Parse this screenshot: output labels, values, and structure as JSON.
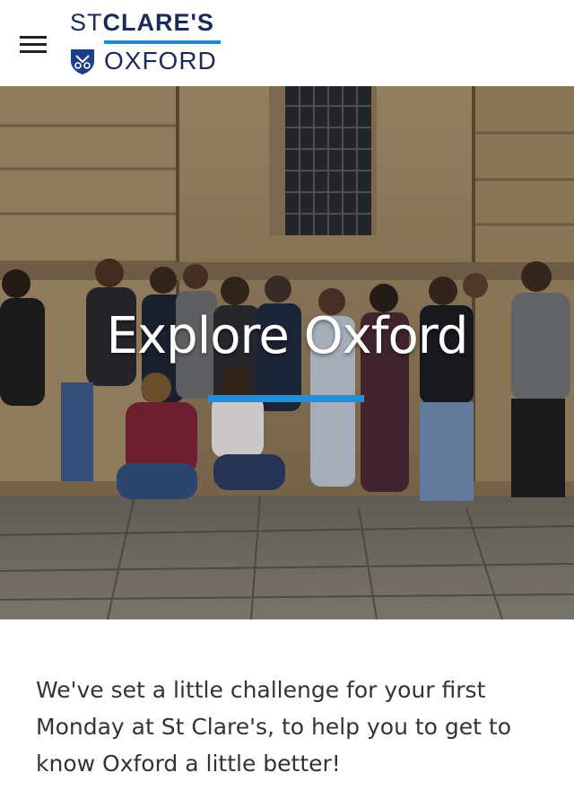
{
  "header": {
    "logo_line1_prefix": "ST",
    "logo_line1_name": "CLARE'S",
    "logo_line2": "OXFORD"
  },
  "hero": {
    "title": "Explore Oxford"
  },
  "intro": {
    "text": "We've set a little challenge for your first Monday at St Clare's, to help you to get to know Oxford a little better!"
  },
  "colors": {
    "brand_navy": "#1c2a5a",
    "accent_blue": "#1e8fe0"
  }
}
